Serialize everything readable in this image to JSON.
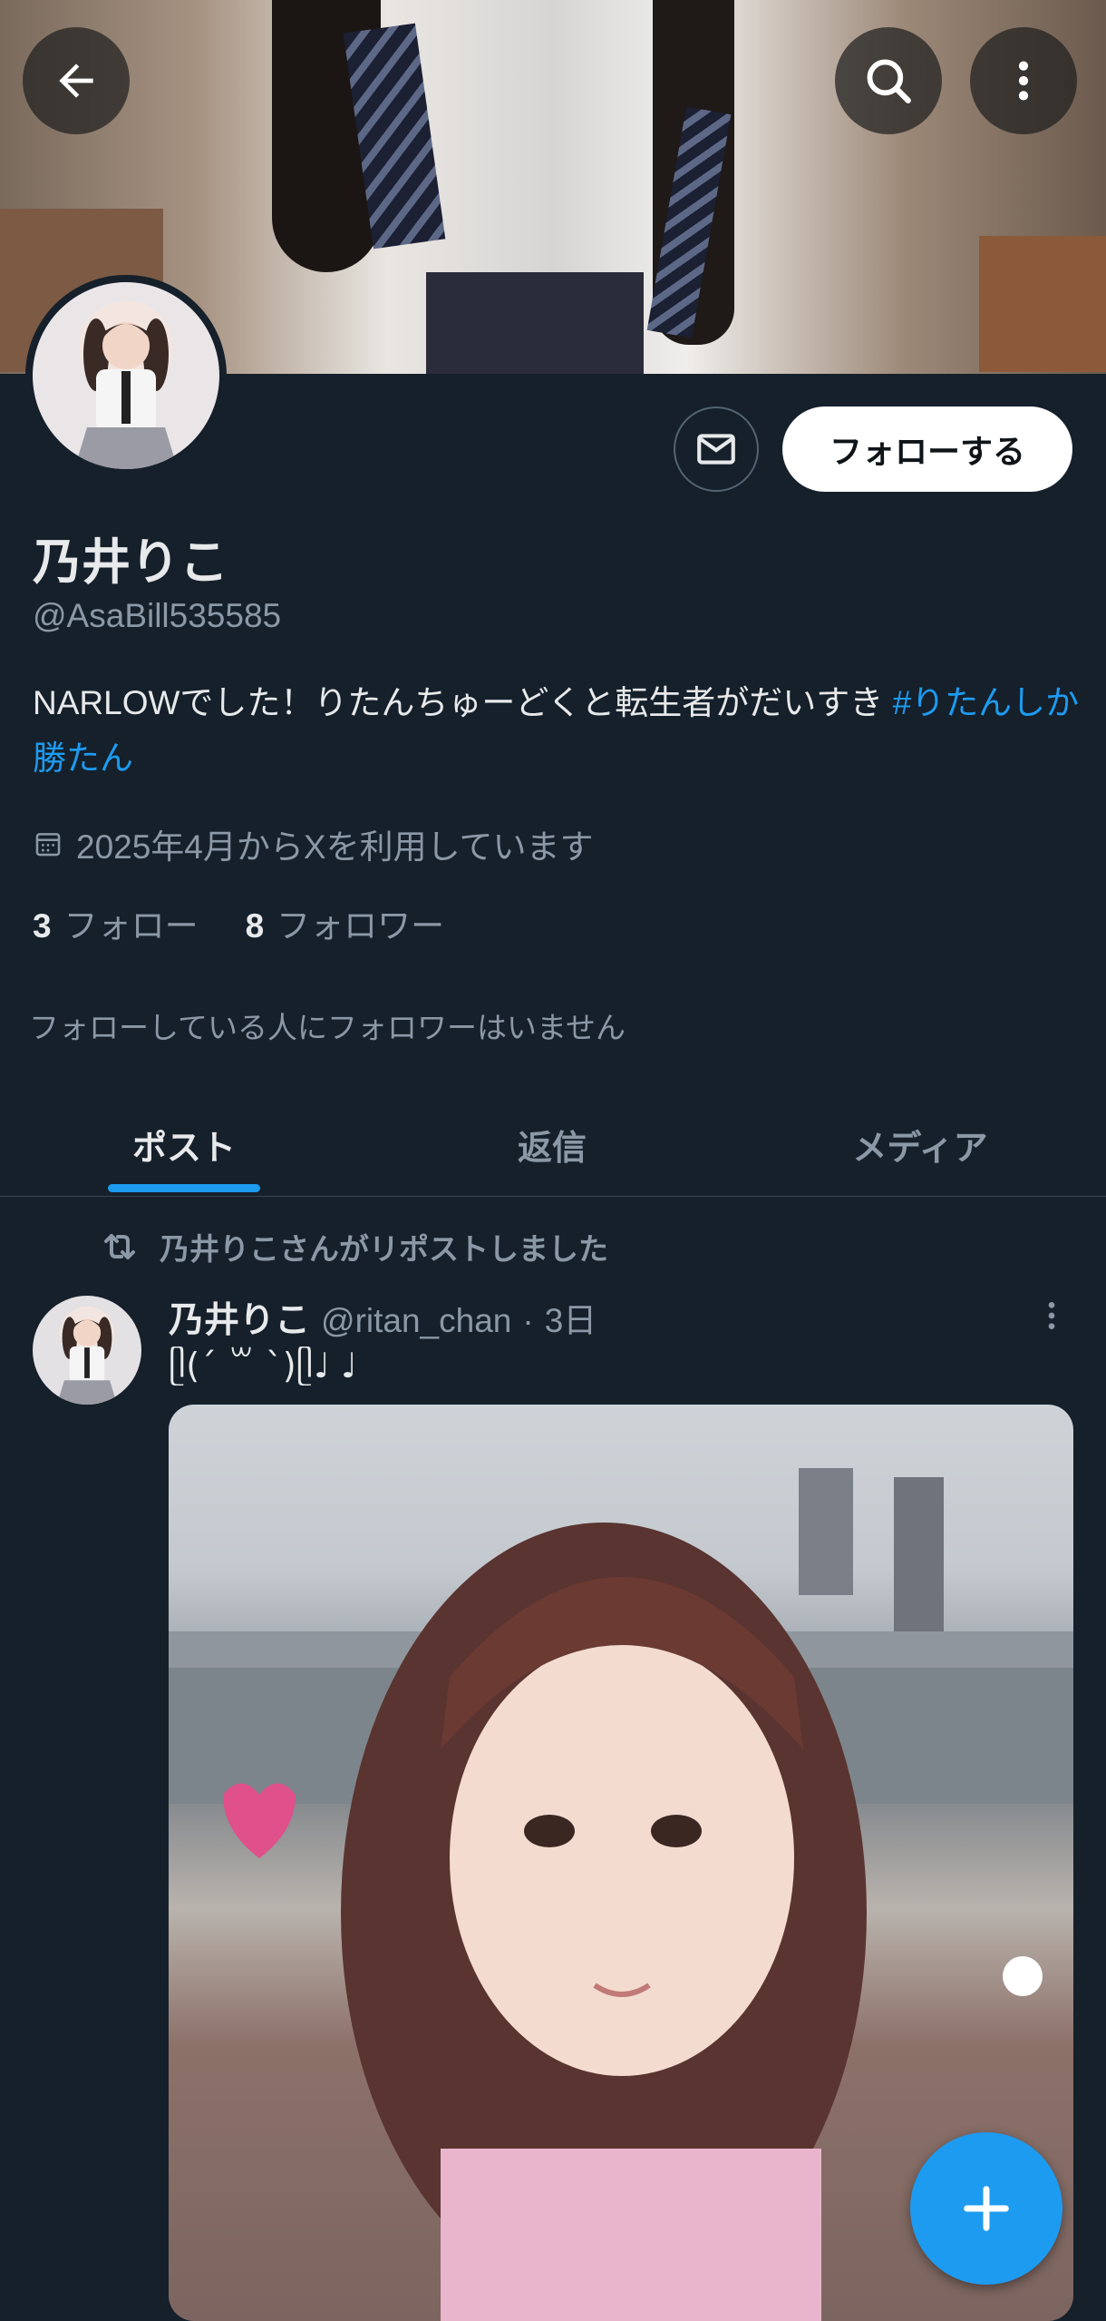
{
  "header": {
    "back_icon": "arrow-left-icon",
    "search_icon": "search-icon",
    "more_icon": "more-vertical-icon"
  },
  "profile": {
    "display_name": "乃井りこ",
    "handle": "@AsaBill535585",
    "bio_text": "NARLOWでした！りたんちゅーどくと転生者がだいすき ",
    "bio_hashtag": "#りたんしか勝たん",
    "joined": "2025年4月からXを利用しています",
    "following_count": "3",
    "following_label": "フォロー",
    "followers_count": "8",
    "followers_label": "フォロワー",
    "followers_you_know": "フォローしている人にフォロワーはいません",
    "follow_button": "フォローする",
    "message_icon": "mail-icon"
  },
  "tabs": [
    {
      "label": "ポスト",
      "active": true
    },
    {
      "label": "返信",
      "active": false
    },
    {
      "label": "メディア",
      "active": false
    }
  ],
  "post": {
    "repost_label": "乃井りこさんがリポストしました",
    "author_name": "乃井りこ",
    "author_handle": "@ritan_chan",
    "separator": "·",
    "time": "3日",
    "text": "ᥫ(ˊ ꒳ ˋ)ᥫ♩ ♩"
  },
  "fab": {
    "icon": "plus-icon"
  },
  "colors": {
    "background": "#15202b",
    "accent": "#1d9bf0",
    "secondary_text": "#8b98a5",
    "primary_text": "#e7e9ea"
  }
}
